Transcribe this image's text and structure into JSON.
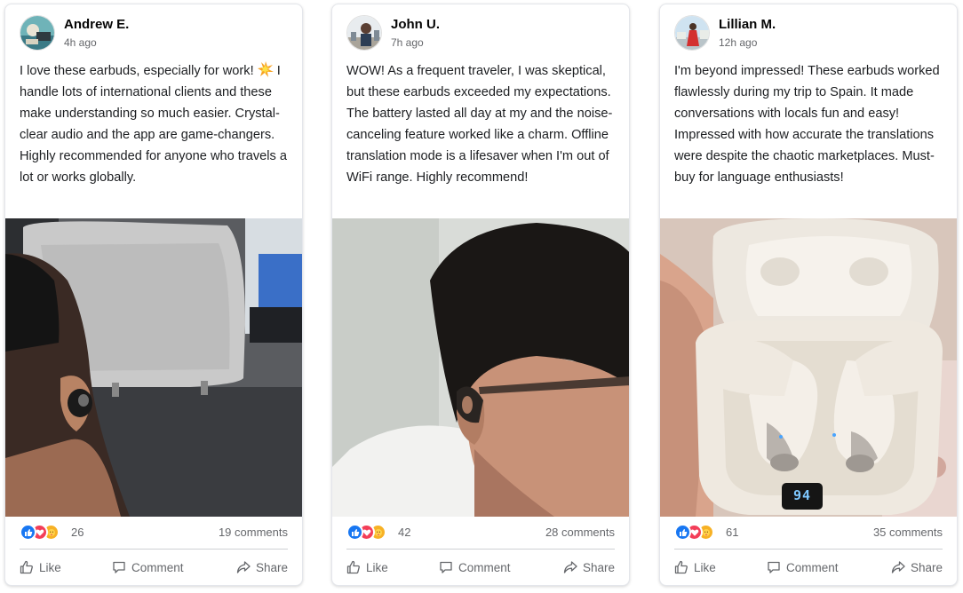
{
  "posts": [
    {
      "author": "Andrew E.",
      "time": "4h ago",
      "text_part1": "I love these earbuds, especially for work!",
      "emoji": "collision-icon",
      "text_part2": "I handle lots of international clients and these make understanding so much easier. Crystal-clear audio and the app are game-changers. Highly recommended for anyone who travels a lot or works globally.",
      "reaction_count": "26",
      "comment_count": "19 comments"
    },
    {
      "author": "John U.",
      "time": "7h ago",
      "text": "WOW! As a frequent traveler, I was skeptical, but these earbuds exceeded my expectations. The battery lasted all day at my and the noise-canceling feature worked like a charm. Offline translation mode is a lifesaver when I'm out of WiFi range. Highly recommend!",
      "reaction_count": "42",
      "comment_count": "28 comments"
    },
    {
      "author": "Lillian M.",
      "time": "12h ago",
      "text": "I'm beyond impressed! These earbuds worked flawlessly during my trip to Spain. It made conversations with locals fun and easy! Impressed with how accurate the translations were despite the chaotic marketplaces. Must-buy for language enthusiasts!",
      "reaction_count": "61",
      "comment_count": "35 comments",
      "case_display": "94"
    }
  ],
  "actions": {
    "like": "Like",
    "comment": "Comment",
    "share": "Share"
  },
  "reactions": [
    "like-icon",
    "love-icon",
    "care-icon"
  ],
  "colors": {
    "like": "#1877f2",
    "love": "#f33e58",
    "care": "#f7b125",
    "meta_text": "#65676b"
  }
}
